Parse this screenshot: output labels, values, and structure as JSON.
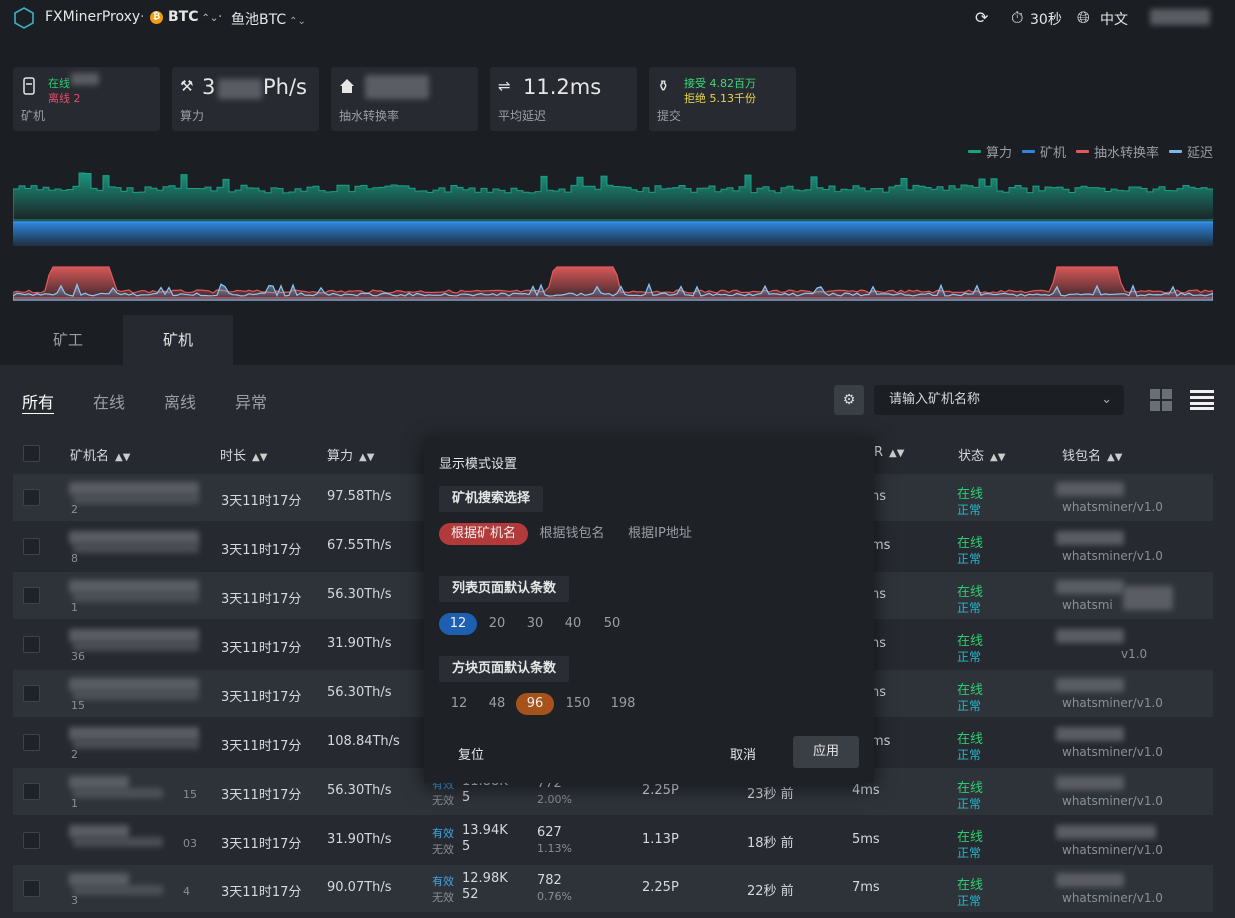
{
  "header": {
    "brand": "FXMinerProxy",
    "coin_symbol": "₿",
    "coin": "BTC",
    "pool": "鱼池BTC",
    "refresh_interval": "30秒",
    "language": "中文"
  },
  "stats": {
    "miners": {
      "online_label": "在线",
      "offline_label": "离线 2",
      "caption": "矿机"
    },
    "hashrate": {
      "value_prefix": "3",
      "value_suffix": "Ph/s",
      "caption": "算力"
    },
    "pump": {
      "caption": "抽水转换率"
    },
    "latency": {
      "value": "11.2ms",
      "caption": "平均延迟"
    },
    "shares": {
      "accepted": "接受 4.82百万",
      "rejected": "拒绝 5.13千份",
      "caption": "提交"
    }
  },
  "legend": [
    {
      "label": "算力",
      "color": "#1aa085"
    },
    {
      "label": "矿机",
      "color": "#2e86de"
    },
    {
      "label": "抽水转换率",
      "color": "#e05a5a"
    },
    {
      "label": "延迟",
      "color": "#7fb8e8"
    }
  ],
  "tabs": {
    "worker": "矿工",
    "miner": "矿机"
  },
  "filters": {
    "all": "所有",
    "online": "在线",
    "offline": "离线",
    "abnormal": "异常"
  },
  "search": {
    "placeholder": "请输入矿机名称"
  },
  "columns": {
    "name": "矿机名",
    "duration": "时长",
    "hashrate": "算力",
    "latency_partial": "R",
    "status": "状态",
    "wallet": "钱包名"
  },
  "rows": [
    {
      "num": "2",
      "duration": "3天11时17分",
      "hashrate": "97.58Th/s",
      "latency": "ns",
      "status": "在线",
      "status2": "正常",
      "wallet": "whatsminer/v1.0"
    },
    {
      "num": "8",
      "duration": "3天11时17分",
      "hashrate": "67.55Th/s",
      "latency": "ms",
      "status": "在线",
      "status2": "正常",
      "wallet": "whatsminer/v1.0"
    },
    {
      "num": "1",
      "duration": "3天11时17分",
      "hashrate": "56.30Th/s",
      "latency": "ns",
      "status": "在线",
      "status2": "正常",
      "wallet": "whatsmi"
    },
    {
      "num": "36",
      "duration": "3天11时17分",
      "hashrate": "31.90Th/s",
      "latency": "ns",
      "status": "在线",
      "status2": "正常",
      "wallet": "v1.0"
    },
    {
      "num": "15",
      "duration": "3天11时17分",
      "hashrate": "56.30Th/s",
      "latency": "ns",
      "status": "在线",
      "status2": "正常",
      "wallet": "whatsminer/v1.0"
    },
    {
      "num": "2",
      "duration": "3天11时17分",
      "hashrate": "108.84Th/s",
      "latency": "ms",
      "status": "在线",
      "status2": "正常",
      "wallet": "whatsminer/v1.0"
    },
    {
      "num": "1",
      "tail": "15",
      "duration": "3天11时17分",
      "hashrate": "56.30Th/s",
      "valid_label": "有效",
      "valid": "11.88K",
      "invalid_label": "无效",
      "invalid": "5",
      "shares": "772",
      "pct": "2.00%",
      "pump": "2.25P",
      "last": "23秒 前",
      "latency": "4ms",
      "status": "在线",
      "status2": "正常",
      "wallet": "whatsminer/v1.0"
    },
    {
      "num": "",
      "tail": "03",
      "duration": "3天11时17分",
      "hashrate": "31.90Th/s",
      "valid_label": "有效",
      "valid": "13.94K",
      "invalid_label": "无效",
      "invalid": "5",
      "shares": "627",
      "pct": "1.13%",
      "pump": "1.13P",
      "last": "18秒 前",
      "latency": "5ms",
      "status": "在线",
      "status2": "正常",
      "wallet": "whatsminer/v1.0"
    },
    {
      "num": "3",
      "tail": "4",
      "duration": "3天11时17分",
      "hashrate": "90.07Th/s",
      "valid_label": "有效",
      "valid": "12.98K",
      "invalid_label": "无效",
      "invalid": "52",
      "shares": "782",
      "pct": "0.76%",
      "pump": "2.25P",
      "last": "22秒 前",
      "latency": "7ms",
      "status": "在线",
      "status2": "正常",
      "wallet": "whatsminer/v1.0"
    }
  ],
  "modal": {
    "title": "显示模式设置",
    "search_section": "矿机搜索选择",
    "search_options": [
      "根据矿机名",
      "根据钱包名",
      "根据IP地址"
    ],
    "list_section": "列表页面默认条数",
    "list_options": [
      "12",
      "20",
      "30",
      "40",
      "50"
    ],
    "block_section": "方块页面默认条数",
    "block_options": [
      "12",
      "48",
      "96",
      "150",
      "198"
    ],
    "reset": "复位",
    "cancel": "取消",
    "apply": "应用"
  }
}
